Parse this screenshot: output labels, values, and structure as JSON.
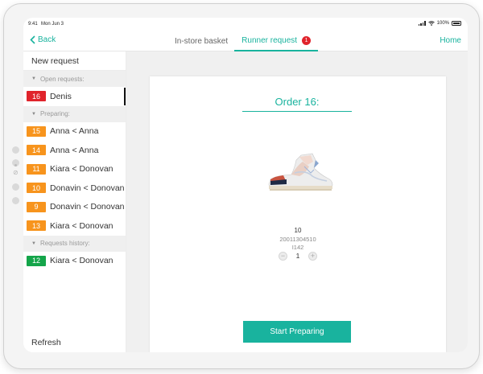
{
  "status_bar": {
    "time": "9:41",
    "date": "Mon Jun 3",
    "battery": "100%"
  },
  "nav": {
    "back_label": "Back",
    "tabs": [
      {
        "label": "In-store basket",
        "active": false
      },
      {
        "label": "Runner request",
        "active": true,
        "badge": "1"
      }
    ],
    "home_label": "Home"
  },
  "sidebar": {
    "new_request": "New request",
    "sections": {
      "open": {
        "header": "Open requests:",
        "items": [
          {
            "number": "16",
            "label": "Denis",
            "color": "#e0242c",
            "selected": true
          }
        ]
      },
      "preparing": {
        "header": "Preparing:",
        "items": [
          {
            "number": "15",
            "label": "Anna < Anna",
            "color": "#f7941d"
          },
          {
            "number": "14",
            "label": "Anna < Anna",
            "color": "#f7941d"
          },
          {
            "number": "11",
            "label": "Kiara < Donovan",
            "color": "#f7941d"
          },
          {
            "number": "10",
            "label": "Donavin < Donovan",
            "color": "#f7941d"
          },
          {
            "number": "9",
            "label": "Donavin < Donovan",
            "color": "#f7941d"
          },
          {
            "number": "13",
            "label": "Kiara < Donovan",
            "color": "#f7941d"
          }
        ]
      },
      "history": {
        "header": "Requests history:",
        "items": [
          {
            "number": "12",
            "label": "Kiara < Donovan",
            "color": "#14a54a"
          }
        ]
      }
    },
    "refresh": "Refresh"
  },
  "order": {
    "title": "Order 16:",
    "size": "10",
    "sku": "20011304510",
    "location": "I142",
    "quantity": "1",
    "start_button": "Start Preparing"
  },
  "colors": {
    "accent": "#19b39e",
    "open": "#e0242c",
    "preparing": "#f7941d",
    "history": "#14a54a"
  }
}
